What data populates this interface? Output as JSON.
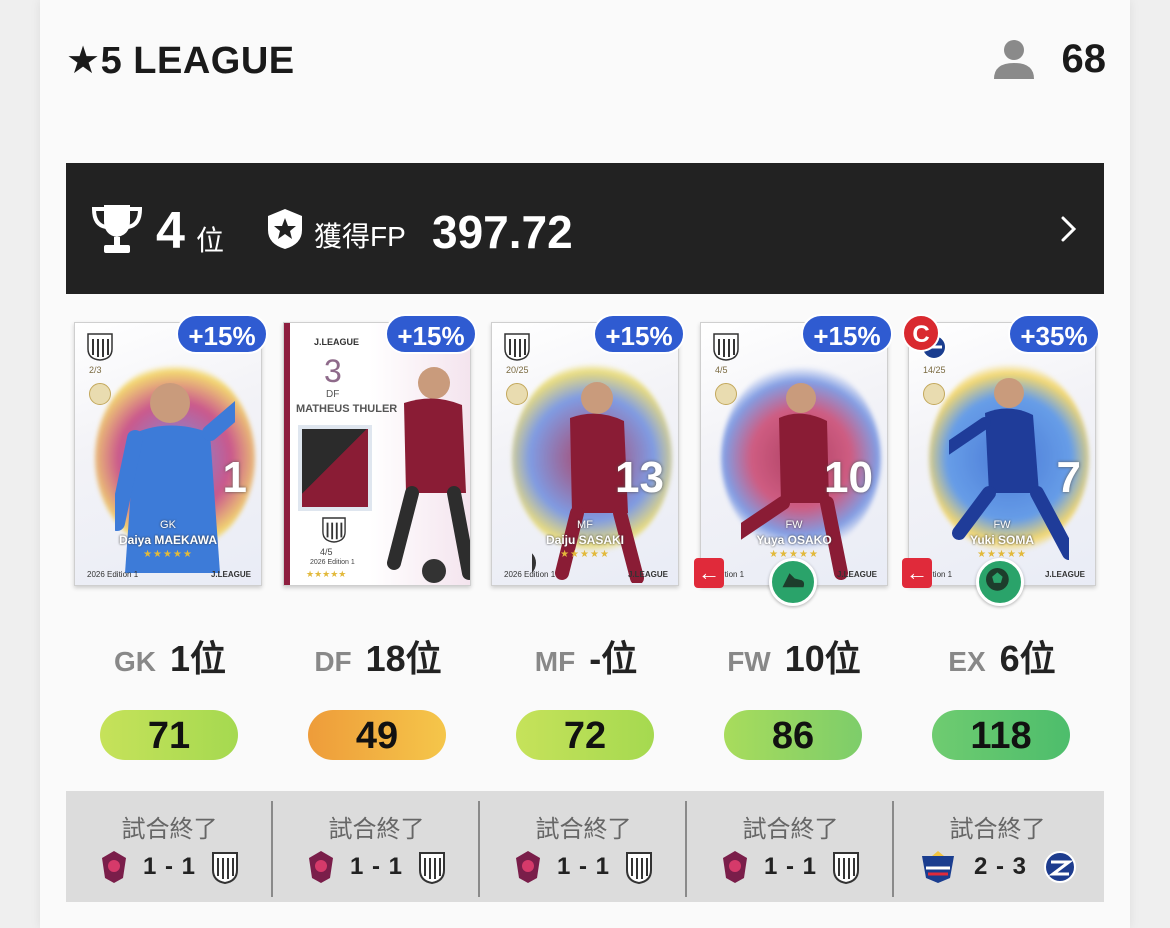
{
  "header": {
    "league_title": "★5 LEAGUE",
    "member_count": "68"
  },
  "rank_bar": {
    "rank": "4",
    "rank_unit": "位",
    "fp_label": "獲得FP",
    "fp_value": "397.72"
  },
  "cards": [
    {
      "bonus": "+15%",
      "serial": "2/3",
      "jersey_number": "1",
      "position": "GK",
      "name": "Daiya MAEKAWA",
      "stars": "★★★★★",
      "edition": "2026 Edition 1",
      "league_mark": "J.LEAGUE",
      "splash_color": "#4f78d9"
    },
    {
      "bonus": "+15%",
      "jl_top": "J.LEAGUE",
      "jersey_number": "3",
      "position": "DF",
      "name": "MATHEUS THULER",
      "serial": "4/5",
      "edition": "2026 Edition 1",
      "stars": "★★★★★"
    },
    {
      "bonus": "+15%",
      "serial": "20/25",
      "jersey_number": "13",
      "position": "MF",
      "name": "Daiju SASAKI",
      "stars": "★★★★★",
      "edition": "2026 Edition 1",
      "league_mark": "J.LEAGUE",
      "splash_color": "#a3224a"
    },
    {
      "bonus": "+15%",
      "serial": "4/5",
      "jersey_number": "10",
      "position": "FW",
      "name": "Yuya OSAKO",
      "stars": "★★★★★",
      "edition": "Edition 1",
      "league_mark": "J.LEAGUE",
      "splash_color": "#a3224a"
    },
    {
      "bonus": "+35%",
      "captain": "C",
      "serial": "14/25",
      "jersey_number": "7",
      "position": "FW",
      "name": "Yuki SOMA",
      "stars": "★★★★★",
      "edition": "Edition 1",
      "league_mark": "J.LEAGUE",
      "splash_color": "#2f66d0"
    }
  ],
  "positions": [
    {
      "code": "GK",
      "rank": "1位"
    },
    {
      "code": "DF",
      "rank": "18位"
    },
    {
      "code": "MF",
      "rank": "-位"
    },
    {
      "code": "FW",
      "rank": "10位"
    },
    {
      "code": "EX",
      "rank": "6位"
    }
  ],
  "scores": [
    {
      "value": "71",
      "color": "#b9dd57"
    },
    {
      "value": "49",
      "color": "#f0b042"
    },
    {
      "value": "72",
      "color": "#b9dd57"
    },
    {
      "value": "86",
      "color": "#8fd463"
    },
    {
      "value": "118",
      "color": "#5cc46f"
    }
  ],
  "results": [
    {
      "status": "試合終了",
      "score": "1 - 1",
      "home_crest": "kyoto-crest",
      "away_crest": "kobe-crest"
    },
    {
      "status": "試合終了",
      "score": "1 - 1",
      "home_crest": "kyoto-crest",
      "away_crest": "kobe-crest"
    },
    {
      "status": "試合終了",
      "score": "1 - 1",
      "home_crest": "kyoto-crest",
      "away_crest": "kobe-crest"
    },
    {
      "status": "試合終了",
      "score": "1 - 1",
      "home_crest": "kyoto-crest",
      "away_crest": "kobe-crest"
    },
    {
      "status": "試合終了",
      "score": "2 - 3",
      "home_crest": "yokohama-fm-crest",
      "away_crest": "machida-crest"
    }
  ],
  "colors": {
    "bonus_badge": "#2f5bd1",
    "captain_badge": "#d9292f",
    "rank_bar": "#222222",
    "sub_arrow": "#e02a3a",
    "skill_badge": "#2aa36a"
  }
}
